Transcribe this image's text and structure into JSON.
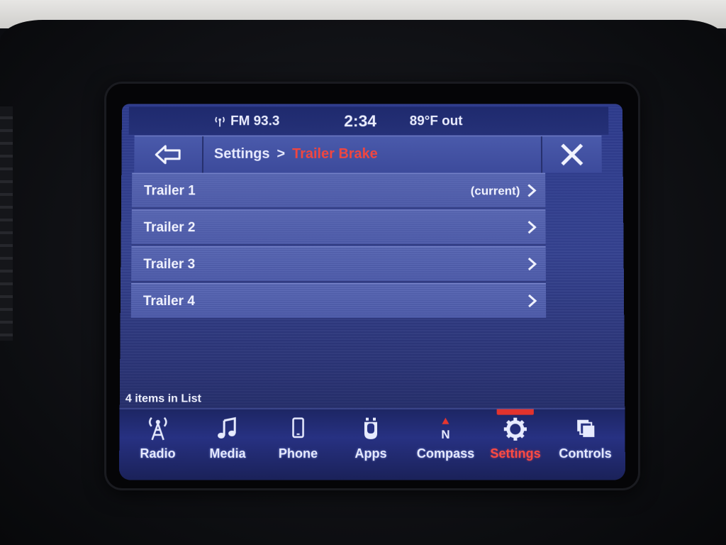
{
  "status": {
    "radio": "FM 93.3",
    "time": "2:34",
    "temperature": "89°F out"
  },
  "header": {
    "breadcrumb_root": "Settings",
    "breadcrumb_separator": ">",
    "breadcrumb_current": "Trailer Brake",
    "icons": {
      "back": "back-arrow-icon",
      "close": "close-icon"
    }
  },
  "list": {
    "items": [
      {
        "label": "Trailer 1",
        "note": "(current)"
      },
      {
        "label": "Trailer 2",
        "note": ""
      },
      {
        "label": "Trailer 3",
        "note": ""
      },
      {
        "label": "Trailer 4",
        "note": ""
      }
    ],
    "count_text": "4 items in List"
  },
  "nav": {
    "active": "Settings",
    "items": [
      {
        "label": "Radio",
        "icon": "radio-tower-icon"
      },
      {
        "label": "Media",
        "icon": "music-note-icon"
      },
      {
        "label": "Phone",
        "icon": "phone-icon"
      },
      {
        "label": "Apps",
        "icon": "apps-icon"
      },
      {
        "label": "Compass",
        "icon": "compass-icon"
      },
      {
        "label": "Settings",
        "icon": "gear-icon"
      },
      {
        "label": "Controls",
        "icon": "controls-icon"
      }
    ]
  },
  "colors": {
    "accent_red": "#f2463f",
    "screen_blue": "#34418f",
    "text": "#f1f3ff"
  }
}
